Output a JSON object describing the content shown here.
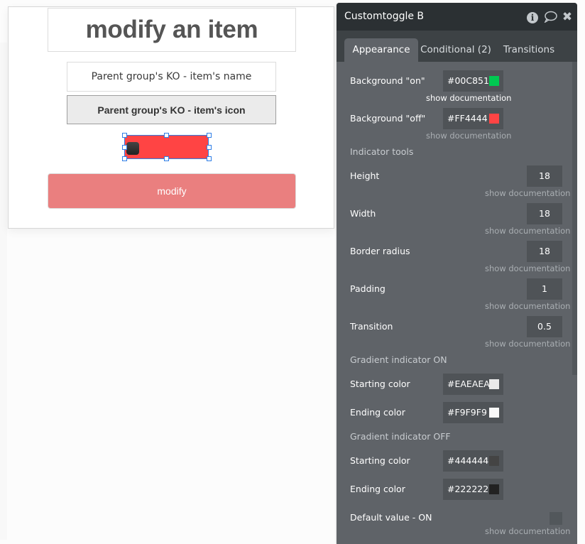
{
  "editor_canvas": {
    "popup": {
      "title": "modify an item",
      "name_field": "Parent group's KO - item's name",
      "icon_field": "Parent group's KO - item's icon",
      "toggle": {
        "state": "off",
        "background_color": "#FF4444",
        "knob_gradient": [
          "#444444",
          "#222222"
        ]
      },
      "modify_button": "modify"
    }
  },
  "panel": {
    "title": "Customtoggle B",
    "header_icons": [
      "info-icon",
      "comment-icon",
      "close-icon"
    ],
    "info_glyph": "i",
    "comment_glyph": "🗨",
    "close_glyph": "✖",
    "tabs": [
      {
        "label": "Appearance",
        "active": true
      },
      {
        "label": "Conditional (2)",
        "active": false
      },
      {
        "label": "Transitions",
        "active": false
      }
    ],
    "doc_link": "show documentation",
    "background_on": {
      "label": "Background \"on\"",
      "value": "#00C851",
      "swatch": "#00C851"
    },
    "background_off": {
      "label": "Background \"off\"",
      "value": "#FF4444",
      "swatch": "#FF4444"
    },
    "indicator_tools_label": "Indicator tools",
    "height": {
      "label": "Height",
      "value": "18"
    },
    "width": {
      "label": "Width",
      "value": "18"
    },
    "border_radius": {
      "label": "Border radius",
      "value": "18"
    },
    "padding": {
      "label": "Padding",
      "value": "1"
    },
    "transition": {
      "label": "Transition",
      "value": "0.5"
    },
    "gradient_on": {
      "label": "Gradient indicator ON",
      "start": {
        "label": "Starting color",
        "value": "#EAEAEA",
        "swatch": "#EAEAEA"
      },
      "end": {
        "label": "Ending color",
        "value": "#F9F9F9",
        "swatch": "#F9F9F9"
      }
    },
    "gradient_off": {
      "label": "Gradient indicator OFF",
      "start": {
        "label": "Starting color",
        "value": "#444444",
        "swatch": "#444444"
      },
      "end": {
        "label": "Ending color",
        "value": "#222222",
        "swatch": "#222222"
      }
    },
    "default_value": {
      "label": "Default value - ON",
      "checked": false
    }
  }
}
